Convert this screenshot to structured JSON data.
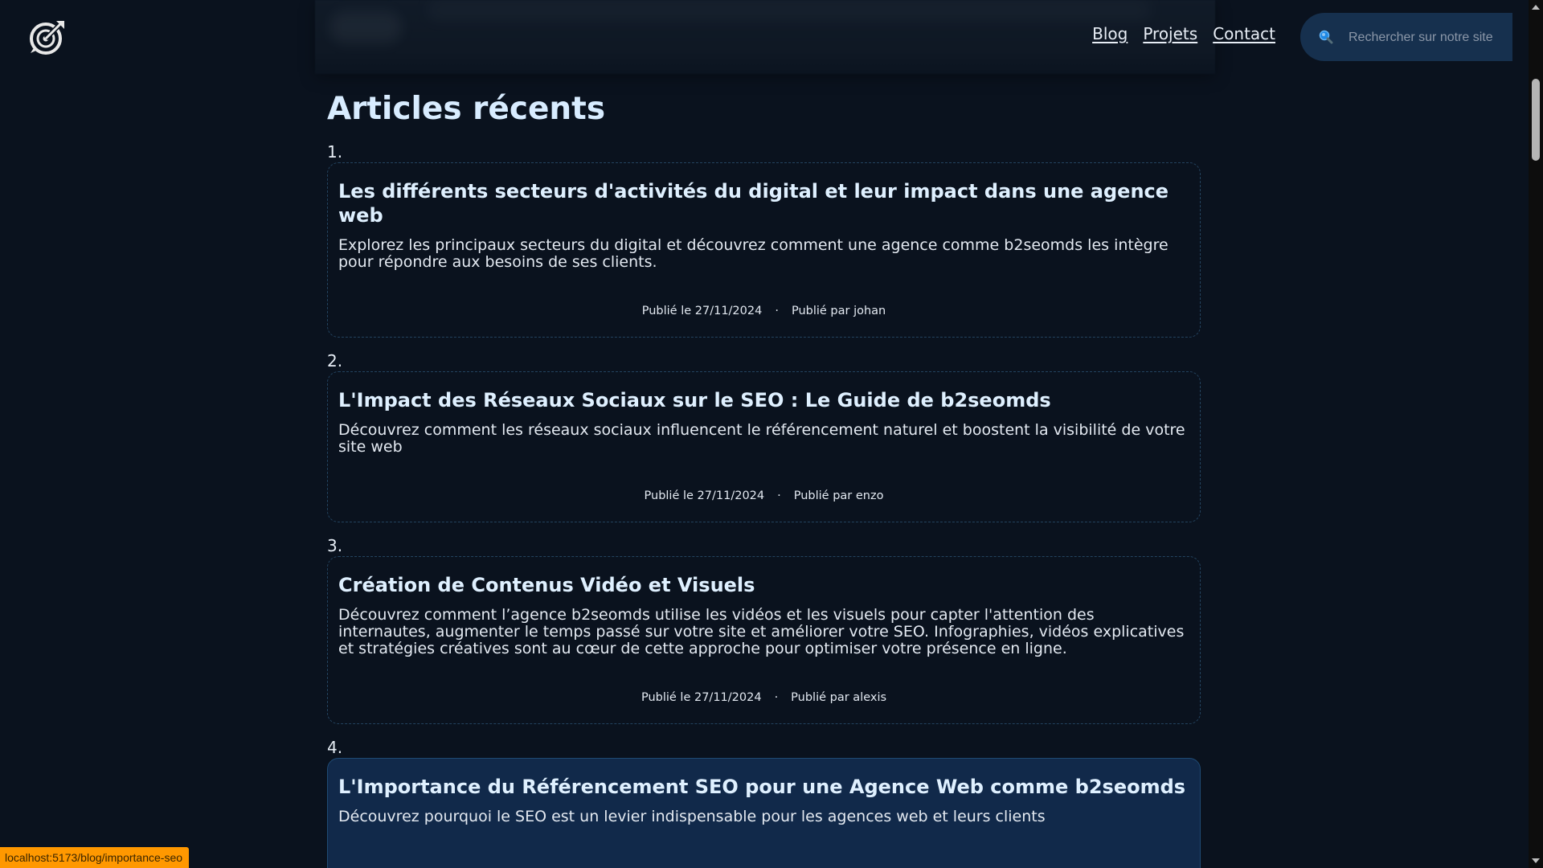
{
  "header": {
    "logo_icon": "rocket-target-logo",
    "nav": [
      {
        "label": "Blog"
      },
      {
        "label": "Projets"
      },
      {
        "label": "Contact"
      }
    ],
    "search": {
      "icon": "search-icon",
      "placeholder": "Rechercher sur notre site"
    }
  },
  "main": {
    "title": "Articles récents",
    "articles": [
      {
        "number": "1.",
        "title": "Les différents secteurs d'activités du digital et leur impact dans une agence web",
        "description": "Explorez les principaux secteurs du digital et découvrez comment une agence comme b2seomds les intègre pour répondre aux besoins de ses clients.",
        "date": "Publié le 27/11/2024",
        "separator": "·",
        "author": "Publié par johan"
      },
      {
        "number": "2.",
        "title": "L'Impact des Réseaux Sociaux sur le SEO : Le Guide de b2seomds",
        "description": "Découvrez comment les réseaux sociaux influencent le référencement naturel et boostent la visibilité de votre site web",
        "date": "Publié le 27/11/2024",
        "separator": "·",
        "author": "Publié par enzo"
      },
      {
        "number": "3.",
        "title": "Création de Contenus Vidéo et Visuels",
        "description": "Découvrez comment l’agence b2seomds utilise les vidéos et les visuels pour capter l'attention des internautes, augmenter le temps passé sur votre site et améliorer votre SEO. Infographies, vidéos explicatives et stratégies créatives sont au cœur de cette approche pour optimiser votre présence en ligne.",
        "date": "Publié le 27/11/2024",
        "separator": "·",
        "author": "Publié par alexis"
      },
      {
        "number": "4.",
        "title": "L'Importance du Référencement SEO pour une Agence Web comme b2seomds",
        "description": "Découvrez pourquoi le SEO est un levier indispensable pour les agences web et leurs clients",
        "date": "",
        "separator": "",
        "author": ""
      }
    ]
  },
  "status_bar": {
    "url": "localhost:5173/blog/importance-seo"
  },
  "colors": {
    "background": "#0a121e",
    "title": "#d8ecff",
    "card_border": "#23435f",
    "card_hover": "#11294a",
    "search_bg": "#16304e",
    "status_bar": "#ff9800"
  }
}
